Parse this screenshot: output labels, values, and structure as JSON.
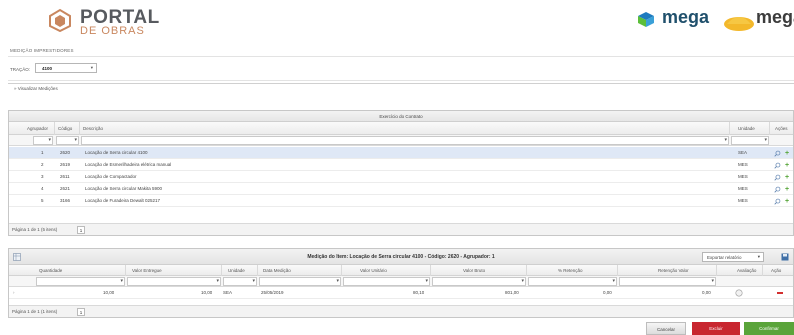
{
  "header": {
    "portal_title": "PORTAL",
    "portal_subtitle": "DE OBRAS",
    "brand1_name": "mega",
    "brand2_name": "mega"
  },
  "page_title": "MEDIÇÃO IMPRESTIDORES",
  "filter": {
    "label": "TRAÇÃO:",
    "value": "4100"
  },
  "fieldset_label": "» Visualizar Medições",
  "grid1": {
    "title": "Exercício do Contrato",
    "columns": [
      "Agrupador",
      "Código",
      "Descrição",
      "Unidade",
      "Ações"
    ],
    "rows": [
      {
        "agrupador": "1",
        "codigo": "2620",
        "descricao": "Locação de Serra circular 4100",
        "unidade": "SEA",
        "selected": true
      },
      {
        "agrupador": "2",
        "codigo": "2619",
        "descricao": "Locação de Esmerilhadeira elétrica manual",
        "unidade": "MES",
        "selected": false
      },
      {
        "agrupador": "3",
        "codigo": "2611",
        "descricao": "Locação de Compactador",
        "unidade": "MES",
        "selected": false
      },
      {
        "agrupador": "4",
        "codigo": "2621",
        "descricao": "Locação de Serra circular Makita 5900",
        "unidade": "MES",
        "selected": false
      },
      {
        "agrupador": "5",
        "codigo": "3166",
        "descricao": "Locação de Furadeira Dewalt 025217",
        "unidade": "MES",
        "selected": false
      }
    ],
    "pager_text": "Página 1 de 1 (5 itens)",
    "pager_page": "1"
  },
  "grid2": {
    "title": "Medição do Item: Locação de Serra circular 4100 - Código: 2620 - Agrupador: 1",
    "export_label": "Exportar relatório",
    "columns": [
      "Quantidade",
      "Valor Entregue",
      "Unidade",
      "Data Medição",
      "Valor Unitário",
      "Valor Bruto",
      "% Retenção",
      "Retenção Valor",
      "Avaliação",
      "Ação"
    ],
    "row": {
      "quantidade": "10,00",
      "valor_entregue": "10,00",
      "unidade": "SEA",
      "data_medicao": "25/05/2019",
      "valor_unitario": "80,10",
      "valor_bruto": "801,00",
      "retencao_pct": "0,00",
      "retencao_valor": "0,00"
    },
    "pager_text": "Página 1 de 1 (1 itens)",
    "pager_page": "1"
  },
  "buttons": {
    "cancel": "Cancelar",
    "delete": "Excluir",
    "confirm": "Confirmar"
  },
  "colors": {
    "selected_row": "#dfe8f6",
    "delete_red": "#c8262f",
    "confirm_green": "#5aa43a",
    "brand_blue": "#20506c"
  }
}
